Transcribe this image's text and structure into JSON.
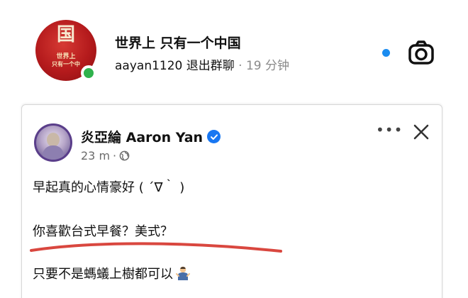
{
  "chat": {
    "group_name": "世界上 只有一个中国",
    "sender": "aayan1120",
    "message": "退出群聊",
    "separator": "·",
    "time": "19 分钟"
  },
  "group_avatar": {
    "seal_char": "国",
    "line1": "世界上",
    "line2": "只有一个中",
    "bg_color": "#b41a1c",
    "online_color": "#2fb24c"
  },
  "unread_color": "#1a8cf0",
  "post": {
    "author": "炎亞綸 Aaron Yan",
    "time": "23 m",
    "meta_sep": "·",
    "line1": "早起真的心情豪好 ( ´∇｀ )",
    "line2": "你喜歡台式早餐？美式？",
    "line3": "只要不是螞蟻上樹都可以",
    "verified_color": "#1877f2",
    "highlight_color": "#d9473f"
  },
  "icons": {
    "camera": "camera-icon",
    "more": "more-horizontal-icon",
    "close": "close-icon",
    "globe": "globe-icon",
    "verified": "verified-badge-icon",
    "emoji": "person-shrugging-emoji"
  },
  "more_glyph": "•••"
}
